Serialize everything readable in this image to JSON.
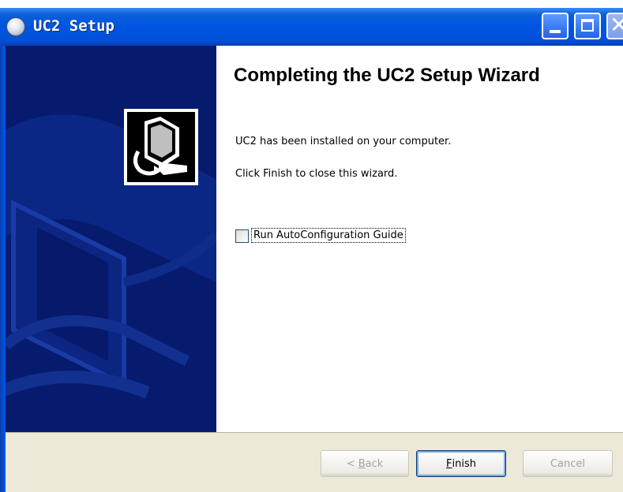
{
  "window": {
    "title": "UC2 Setup",
    "icon": "setup-disc-icon",
    "controls": [
      "minimize-icon",
      "maximize-icon",
      "close-icon"
    ],
    "close_glyph": "✕"
  },
  "wizard": {
    "heading": "Completing the UC2 Setup Wizard",
    "message_installed": "UC2 has been installed on your computer.",
    "message_finish": "Click Finish to close this wizard.",
    "checkbox": {
      "label": "Run AutoConfiguration Guide",
      "checked": false
    }
  },
  "buttons": {
    "back": {
      "mnemonic": "B",
      "rest": "ack",
      "prefix": "< ",
      "enabled": false
    },
    "finish": {
      "mnemonic": "F",
      "rest": "inish",
      "enabled": true
    },
    "cancel": {
      "label": "Cancel",
      "enabled": false
    }
  },
  "colors": {
    "titlebar": "#0054e3",
    "sidebar": "#071b6e",
    "dialog_face": "#ece9d8"
  }
}
